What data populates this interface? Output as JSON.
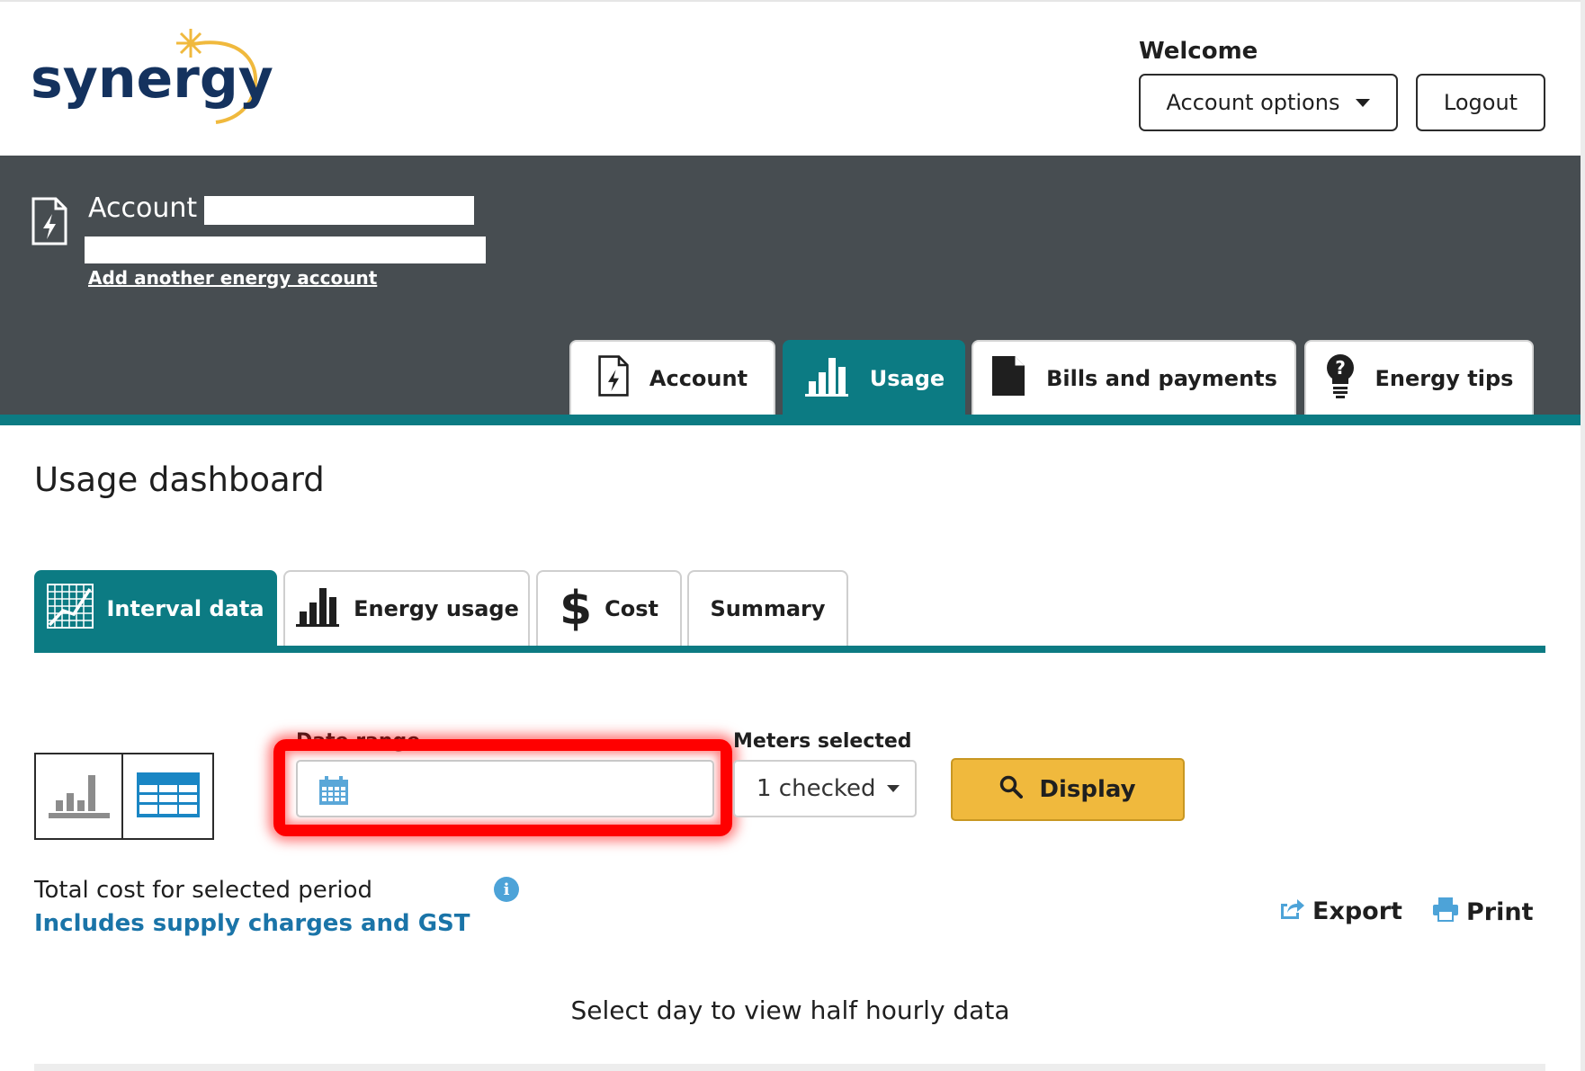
{
  "brand": {
    "name": "synergy",
    "text_color": "#14325e",
    "swoosh_color": "#f0b93d"
  },
  "header": {
    "welcome": "Welcome",
    "account_options_label": "Account options",
    "logout_label": "Logout"
  },
  "account_band": {
    "label": "Account",
    "add_account_link": "Add another energy account",
    "background": "#474d51",
    "accent": "#0c7b83"
  },
  "main_tabs": [
    {
      "label": "Account",
      "icon": "account-bolt-icon",
      "active": false
    },
    {
      "label": "Usage",
      "icon": "bar-chart-icon",
      "active": true
    },
    {
      "label": "Bills and payments",
      "icon": "document-icon",
      "active": false
    },
    {
      "label": "Energy tips",
      "icon": "lightbulb-icon",
      "active": false
    }
  ],
  "page_title": "Usage dashboard",
  "sub_tabs": [
    {
      "label": "Interval data",
      "icon": "interval-grid-icon",
      "active": true
    },
    {
      "label": "Energy usage",
      "icon": "bar-chart-icon",
      "active": false
    },
    {
      "label": "Cost",
      "icon": "dollar-icon",
      "active": false
    },
    {
      "label": "Summary",
      "icon": "",
      "active": false
    }
  ],
  "controls": {
    "date_range_label": "Date range",
    "date_range_value": "",
    "meters_label": "Meters selected",
    "meters_value": "1 checked",
    "display_label": "Display",
    "display_color": "#f0b93d"
  },
  "totals": {
    "total_label": "Total cost for selected period",
    "includes_label": "Includes supply charges and GST",
    "info_icon_glyph": "i"
  },
  "actions": {
    "export_label": "Export",
    "print_label": "Print"
  },
  "instruction": "Select day to view half hourly data"
}
